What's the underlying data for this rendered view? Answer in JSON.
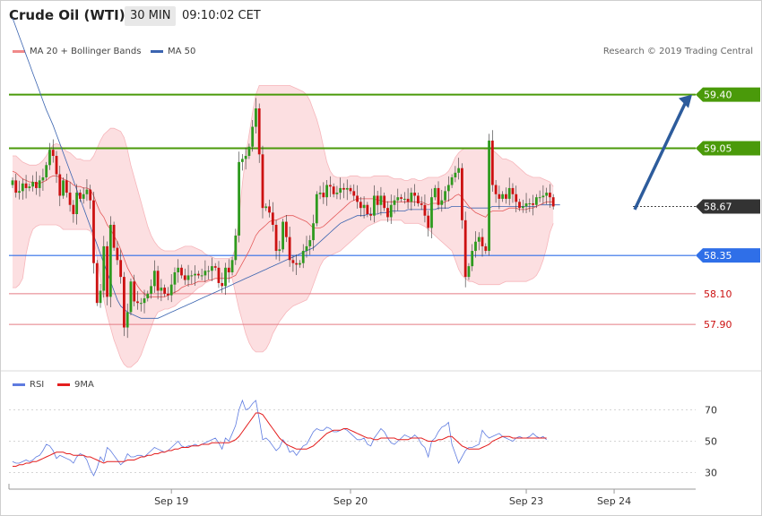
{
  "header": {
    "instrument": "Crude Oil (WTI)",
    "timeframe": "30 MIN",
    "time": "09:10:02 CET"
  },
  "legend": {
    "ma20_label": "MA 20 + Bollinger Bands",
    "ma50_label": "MA 50",
    "rsi_label": "RSI",
    "ma9_label": "9MA"
  },
  "credit": "Research © 2019 Trading Central",
  "colors": {
    "bull": "#2e9a1e",
    "bear": "#cc1111",
    "ma20": "#e45a5a",
    "ma50": "#3b64b0",
    "band_fill": "#fbd9dc",
    "green_level": "#4a9a0a",
    "blue_level": "#2f6fe8",
    "red_level": "#e47b84",
    "rsi": "#5e7be0",
    "rsi_ma": "#e41e1e",
    "arrow": "#2d5c9c"
  },
  "chart_data": {
    "type": "candlestick",
    "title": "Crude Oil (WTI)",
    "timeframe": "30 MIN",
    "x_tick_labels": [
      "Sep 19",
      "Sep 20",
      "Sep 23",
      "Sep 24"
    ],
    "x_tick_bar_index": [
      47,
      100,
      152,
      178
    ],
    "ylim": [
      57.62,
      59.62
    ],
    "levels": [
      {
        "value": 59.4,
        "label": "59.40",
        "kind": "resistance"
      },
      {
        "value": 59.05,
        "label": "59.05",
        "kind": "resistance"
      },
      {
        "value": 58.67,
        "label": "58.67",
        "kind": "last"
      },
      {
        "value": 58.35,
        "label": "58.35",
        "kind": "pivot"
      },
      {
        "value": 58.1,
        "label": "58.10",
        "kind": "support"
      },
      {
        "value": 57.9,
        "label": "57.90",
        "kind": "support"
      }
    ],
    "target_arrow": {
      "from_value": 58.65,
      "to_value": 59.4
    },
    "candles_close": [
      58.84,
      58.76,
      58.77,
      58.82,
      58.79,
      58.8,
      58.83,
      58.79,
      58.84,
      58.86,
      58.94,
      59.04,
      59.0,
      58.88,
      58.74,
      58.84,
      58.76,
      58.68,
      58.62,
      58.76,
      58.72,
      58.75,
      58.78,
      58.71,
      58.3,
      58.04,
      58.12,
      58.41,
      58.08,
      58.55,
      58.4,
      58.32,
      58.21,
      57.88,
      57.98,
      58.18,
      58.05,
      58.04,
      58.04,
      58.07,
      58.1,
      58.15,
      58.25,
      58.12,
      58.14,
      58.1,
      58.09,
      58.16,
      58.24,
      58.27,
      58.22,
      58.19,
      58.22,
      58.22,
      58.23,
      58.22,
      58.22,
      58.25,
      58.25,
      58.28,
      58.27,
      58.17,
      58.15,
      58.27,
      58.24,
      58.32,
      58.48,
      58.96,
      58.98,
      59.0,
      59.06,
      59.19,
      59.31,
      59.01,
      58.66,
      58.67,
      58.63,
      58.55,
      58.38,
      58.39,
      58.57,
      58.47,
      58.32,
      58.3,
      58.29,
      58.3,
      58.38,
      58.41,
      58.45,
      58.56,
      58.75,
      58.76,
      58.73,
      58.81,
      58.8,
      58.75,
      58.76,
      58.79,
      58.78,
      58.79,
      58.77,
      58.74,
      58.7,
      58.66,
      58.68,
      58.62,
      58.61,
      58.74,
      58.68,
      58.74,
      58.66,
      58.6,
      58.68,
      58.71,
      58.73,
      58.72,
      58.72,
      58.7,
      58.76,
      58.74,
      58.69,
      58.68,
      58.61,
      58.53,
      58.73,
      58.79,
      58.68,
      58.71,
      58.77,
      58.81,
      58.86,
      58.89,
      58.92,
      58.58,
      58.21,
      58.28,
      58.38,
      58.44,
      58.47,
      58.41,
      58.38,
      59.1,
      58.81,
      58.75,
      58.72,
      58.75,
      58.72,
      58.79,
      58.75,
      58.7,
      58.66,
      58.67,
      58.69,
      58.69,
      58.68,
      58.73,
      58.73,
      58.74,
      58.76,
      58.73,
      58.67
    ],
    "candles_open": [
      58.81,
      58.84,
      58.76,
      58.77,
      58.82,
      58.79,
      58.8,
      58.83,
      58.79,
      58.84,
      58.86,
      58.94,
      59.04,
      59.0,
      58.88,
      58.74,
      58.84,
      58.76,
      58.68,
      58.62,
      58.76,
      58.72,
      58.75,
      58.78,
      58.71,
      58.3,
      58.04,
      58.12,
      58.41,
      58.08,
      58.55,
      58.4,
      58.32,
      58.21,
      57.88,
      57.98,
      58.18,
      58.05,
      58.04,
      58.04,
      58.07,
      58.1,
      58.15,
      58.25,
      58.12,
      58.14,
      58.1,
      58.09,
      58.16,
      58.24,
      58.27,
      58.22,
      58.19,
      58.22,
      58.22,
      58.23,
      58.22,
      58.22,
      58.25,
      58.25,
      58.28,
      58.27,
      58.17,
      58.15,
      58.27,
      58.24,
      58.32,
      58.48,
      58.96,
      58.98,
      59.0,
      59.06,
      59.19,
      59.31,
      59.01,
      58.66,
      58.67,
      58.63,
      58.55,
      58.38,
      58.39,
      58.57,
      58.47,
      58.32,
      58.3,
      58.29,
      58.3,
      58.38,
      58.41,
      58.45,
      58.56,
      58.75,
      58.76,
      58.73,
      58.81,
      58.8,
      58.75,
      58.76,
      58.79,
      58.78,
      58.79,
      58.77,
      58.74,
      58.7,
      58.66,
      58.68,
      58.62,
      58.61,
      58.74,
      58.68,
      58.74,
      58.66,
      58.6,
      58.68,
      58.71,
      58.73,
      58.72,
      58.72,
      58.7,
      58.76,
      58.74,
      58.69,
      58.68,
      58.61,
      58.53,
      58.73,
      58.79,
      58.68,
      58.71,
      58.77,
      58.81,
      58.86,
      58.89,
      58.92,
      58.58,
      58.21,
      58.28,
      58.38,
      58.44,
      58.47,
      58.41,
      58.38,
      59.1,
      58.81,
      58.75,
      58.72,
      58.75,
      58.72,
      58.79,
      58.75,
      58.7,
      58.66,
      58.67,
      58.69,
      58.69,
      58.68,
      58.73,
      58.73,
      58.74,
      58.76,
      58.73
    ],
    "ma20": [
      58.9,
      58.89,
      58.87,
      58.85,
      58.84,
      58.83,
      58.83,
      58.82,
      58.82,
      58.83,
      58.84,
      58.86,
      58.87,
      58.87,
      58.86,
      58.85,
      58.84,
      58.83,
      58.81,
      58.8,
      58.8,
      58.79,
      58.79,
      58.78,
      58.74,
      58.68,
      58.63,
      58.6,
      58.55,
      58.52,
      58.48,
      58.44,
      58.39,
      58.33,
      58.27,
      58.23,
      58.19,
      58.15,
      58.12,
      58.1,
      58.08,
      58.08,
      58.08,
      58.08,
      58.08,
      58.08,
      58.09,
      58.1,
      58.11,
      58.12,
      58.14,
      58.15,
      58.16,
      58.16,
      58.17,
      58.18,
      58.18,
      58.18,
      58.19,
      58.19,
      58.2,
      58.2,
      58.2,
      58.2,
      58.2,
      58.21,
      58.22,
      58.26,
      58.3,
      58.34,
      58.38,
      58.43,
      58.48,
      58.51,
      58.53,
      58.55,
      58.57,
      58.58,
      58.58,
      58.59,
      58.6,
      58.61,
      58.61,
      58.61,
      58.6,
      58.59,
      58.58,
      58.57,
      58.55,
      58.53,
      58.53,
      58.53,
      58.54,
      58.56,
      58.58,
      58.6,
      58.62,
      58.64,
      58.66,
      58.68,
      58.7,
      58.71,
      58.72,
      58.72,
      58.72,
      58.72,
      58.72,
      58.72,
      58.71,
      58.71,
      58.7,
      58.7,
      58.7,
      58.7,
      58.7,
      58.7,
      58.7,
      58.7,
      58.7,
      58.7,
      58.7,
      58.7,
      58.69,
      58.68,
      58.69,
      58.69,
      58.69,
      58.69,
      58.7,
      58.71,
      58.72,
      58.74,
      58.75,
      58.73,
      58.7,
      58.67,
      58.65,
      58.63,
      58.62,
      58.61,
      58.6,
      58.63,
      58.64,
      58.64,
      58.64,
      58.64,
      58.65,
      58.66,
      58.66,
      58.66,
      58.65,
      58.65,
      58.65,
      58.66,
      58.66,
      58.67,
      58.68,
      58.69,
      58.7,
      58.7,
      58.7
    ],
    "bb_upper": [
      59.0,
      59.0,
      58.98,
      58.96,
      58.95,
      58.94,
      58.94,
      58.94,
      58.95,
      58.97,
      59.0,
      59.04,
      59.07,
      59.08,
      59.07,
      59.05,
      59.03,
      59.02,
      59.0,
      58.98,
      58.98,
      58.97,
      58.97,
      58.97,
      59.0,
      59.05,
      59.1,
      59.14,
      59.16,
      59.18,
      59.18,
      59.17,
      59.16,
      59.12,
      59.04,
      58.94,
      58.86,
      58.78,
      58.7,
      58.62,
      58.54,
      58.48,
      58.44,
      58.41,
      58.39,
      58.38,
      58.38,
      58.38,
      58.38,
      58.39,
      58.4,
      58.41,
      58.41,
      58.41,
      58.4,
      58.39,
      58.38,
      58.36,
      58.35,
      58.34,
      58.33,
      58.33,
      58.33,
      58.33,
      58.33,
      58.34,
      58.4,
      58.6,
      58.82,
      59.0,
      59.14,
      59.28,
      59.4,
      59.46,
      59.46,
      59.46,
      59.46,
      59.46,
      59.46,
      59.46,
      59.46,
      59.46,
      59.46,
      59.45,
      59.44,
      59.43,
      59.42,
      59.4,
      59.36,
      59.3,
      59.24,
      59.16,
      59.06,
      58.96,
      58.9,
      58.87,
      58.86,
      58.86,
      58.86,
      58.86,
      58.87,
      58.87,
      58.87,
      58.86,
      58.86,
      58.86,
      58.86,
      58.87,
      58.87,
      58.87,
      58.87,
      58.87,
      58.86,
      58.85,
      58.85,
      58.85,
      58.84,
      58.84,
      58.85,
      58.85,
      58.84,
      58.84,
      58.85,
      58.86,
      58.86,
      58.86,
      58.86,
      58.87,
      58.88,
      58.9,
      58.94,
      58.99,
      59.02,
      59.04,
      59.05,
      59.05,
      59.05,
      59.05,
      59.05,
      59.05,
      59.04,
      59.05,
      59.04,
      59.02,
      59.0,
      58.98,
      58.98,
      58.97,
      58.96,
      58.94,
      58.92,
      58.9,
      58.88,
      58.87,
      58.86,
      58.86,
      58.86,
      58.85,
      58.84,
      58.83,
      58.8
    ],
    "bb_lower": [
      58.14,
      58.14,
      58.16,
      58.2,
      58.36,
      58.46,
      58.52,
      58.54,
      58.55,
      58.55,
      58.55,
      58.55,
      58.55,
      58.55,
      58.54,
      58.52,
      58.52,
      58.52,
      58.52,
      58.52,
      58.52,
      58.52,
      58.52,
      58.51,
      58.46,
      58.34,
      58.2,
      58.06,
      57.96,
      57.88,
      57.8,
      57.74,
      57.68,
      57.64,
      57.62,
      57.62,
      57.64,
      57.66,
      57.7,
      57.76,
      57.82,
      57.88,
      57.94,
      57.98,
      57.99,
      58.0,
      58.0,
      58.01,
      58.02,
      58.04,
      58.06,
      58.07,
      58.08,
      58.1,
      58.12,
      58.14,
      58.15,
      58.17,
      58.18,
      58.19,
      58.2,
      58.2,
      58.2,
      58.2,
      58.2,
      58.2,
      58.1,
      58.0,
      57.92,
      57.84,
      57.78,
      57.74,
      57.72,
      57.72,
      57.72,
      57.74,
      57.78,
      57.84,
      57.88,
      57.92,
      57.95,
      57.98,
      58.0,
      58.02,
      58.03,
      58.04,
      58.05,
      58.06,
      58.1,
      58.16,
      58.22,
      58.28,
      58.32,
      58.34,
      58.35,
      58.36,
      58.37,
      58.38,
      58.4,
      58.42,
      58.44,
      58.46,
      58.48,
      58.5,
      58.52,
      58.54,
      58.55,
      58.56,
      58.57,
      58.58,
      58.58,
      58.58,
      58.58,
      58.58,
      58.58,
      58.58,
      58.56,
      58.56,
      58.56,
      58.56,
      58.56,
      58.55,
      58.54,
      58.52,
      58.5,
      58.48,
      58.46,
      58.44,
      58.42,
      58.4,
      58.38,
      58.32,
      58.26,
      58.22,
      58.2,
      58.18,
      58.18,
      58.17,
      58.16,
      58.16,
      58.16,
      58.16,
      58.16,
      58.16,
      58.16,
      58.17,
      58.18,
      58.18,
      58.18,
      58.18,
      58.18,
      58.18,
      58.18,
      58.19,
      58.2,
      58.22,
      58.26,
      58.32,
      58.4,
      58.5,
      58.56
    ],
    "ma50": [
      59.9,
      59.84,
      59.78,
      59.72,
      59.66,
      59.6,
      59.54,
      59.48,
      59.42,
      59.36,
      59.3,
      59.25,
      59.2,
      59.14,
      59.08,
      59.02,
      58.96,
      58.9,
      58.84,
      58.78,
      58.72,
      58.66,
      58.6,
      58.54,
      58.48,
      58.42,
      58.36,
      58.3,
      58.24,
      58.18,
      58.12,
      58.06,
      58.02,
      58.0,
      57.98,
      57.97,
      57.96,
      57.95,
      57.94,
      57.94,
      57.94,
      57.94,
      57.94,
      57.94,
      57.95,
      57.96,
      57.97,
      57.98,
      57.99,
      58.0,
      58.01,
      58.02,
      58.03,
      58.04,
      58.05,
      58.06,
      58.07,
      58.08,
      58.09,
      58.1,
      58.11,
      58.12,
      58.13,
      58.14,
      58.15,
      58.16,
      58.17,
      58.18,
      58.19,
      58.2,
      58.21,
      58.22,
      58.23,
      58.24,
      58.25,
      58.26,
      58.27,
      58.28,
      58.29,
      58.3,
      58.31,
      58.32,
      58.33,
      58.34,
      58.35,
      58.36,
      58.37,
      58.38,
      58.39,
      58.4,
      58.42,
      58.44,
      58.46,
      58.48,
      58.5,
      58.52,
      58.54,
      58.56,
      58.57,
      58.58,
      58.59,
      58.6,
      58.61,
      58.61,
      58.61,
      58.62,
      58.62,
      58.62,
      58.62,
      58.63,
      58.63,
      58.63,
      58.64,
      58.64,
      58.64,
      58.64,
      58.64,
      58.65,
      58.65,
      58.65,
      58.65,
      58.65,
      58.65,
      58.65,
      58.65,
      58.65,
      58.66,
      58.66,
      58.66,
      58.66,
      58.67,
      58.67,
      58.67,
      58.67,
      58.67,
      58.66,
      58.66,
      58.66,
      58.66,
      58.66,
      58.66,
      58.66,
      58.67,
      58.67,
      58.67,
      58.67,
      58.67,
      58.67,
      58.67,
      58.67,
      58.67,
      58.67,
      58.67,
      58.67,
      58.67,
      58.67,
      58.68,
      58.68,
      58.68,
      58.68,
      58.68,
      58.68,
      58.68
    ],
    "rsi": {
      "ylim": [
        20,
        80
      ],
      "ticks": [
        30,
        50,
        70
      ],
      "rsi_values": [
        37,
        36,
        36,
        37,
        38,
        37,
        38,
        40,
        41,
        44,
        48,
        47,
        44,
        39,
        41,
        40,
        39,
        38,
        36,
        40,
        42,
        41,
        38,
        32,
        28,
        33,
        40,
        37,
        46,
        44,
        41,
        38,
        35,
        37,
        42,
        40,
        40,
        41,
        41,
        40,
        42,
        44,
        46,
        45,
        44,
        43,
        44,
        46,
        48,
        50,
        47,
        46,
        47,
        47,
        48,
        47,
        48,
        49,
        50,
        51,
        52,
        49,
        45,
        52,
        50,
        55,
        60,
        70,
        76,
        70,
        71,
        74,
        76,
        64,
        51,
        52,
        50,
        47,
        44,
        46,
        51,
        48,
        43,
        44,
        41,
        44,
        47,
        48,
        52,
        56,
        58,
        57,
        57,
        59,
        58,
        56,
        56,
        57,
        58,
        57,
        55,
        53,
        51,
        51,
        52,
        48,
        47,
        52,
        55,
        58,
        56,
        52,
        49,
        48,
        50,
        52,
        54,
        53,
        52,
        54,
        52,
        48,
        46,
        40,
        50,
        52,
        56,
        59,
        60,
        62,
        48,
        42,
        36,
        40,
        44,
        46,
        46,
        47,
        48,
        57,
        54,
        52,
        53,
        54,
        55,
        53,
        52,
        51,
        50,
        52,
        53,
        52,
        52,
        53,
        55,
        53,
        52,
        53,
        51
      ],
      "ma_values": [
        34,
        34,
        35,
        35,
        36,
        36,
        37,
        37,
        38,
        39,
        40,
        41,
        42,
        43,
        43,
        43,
        42,
        42,
        41,
        41,
        41,
        41,
        40,
        40,
        39,
        38,
        37,
        36,
        37,
        37,
        37,
        37,
        37,
        37,
        38,
        38,
        38,
        39,
        40,
        40,
        41,
        41,
        42,
        42,
        43,
        43,
        44,
        44,
        45,
        45,
        46,
        46,
        46,
        47,
        47,
        47,
        48,
        48,
        48,
        49,
        49,
        49,
        49,
        49,
        49,
        50,
        51,
        53,
        56,
        59,
        62,
        65,
        68,
        68,
        67,
        64,
        61,
        58,
        55,
        52,
        50,
        48,
        47,
        46,
        45,
        45,
        45,
        45,
        46,
        47,
        49,
        51,
        53,
        55,
        56,
        57,
        57,
        57,
        58,
        58,
        57,
        56,
        55,
        54,
        53,
        52,
        52,
        51,
        51,
        52,
        52,
        52,
        52,
        52,
        51,
        51,
        51,
        51,
        52,
        52,
        52,
        52,
        51,
        50,
        50,
        50,
        51,
        51,
        52,
        53,
        53,
        51,
        49,
        47,
        46,
        45,
        45,
        45,
        45,
        46,
        47,
        48,
        50,
        51,
        52,
        53,
        53,
        53,
        52,
        52,
        52,
        52,
        52,
        52,
        52,
        52,
        52,
        52,
        52
      ]
    }
  }
}
